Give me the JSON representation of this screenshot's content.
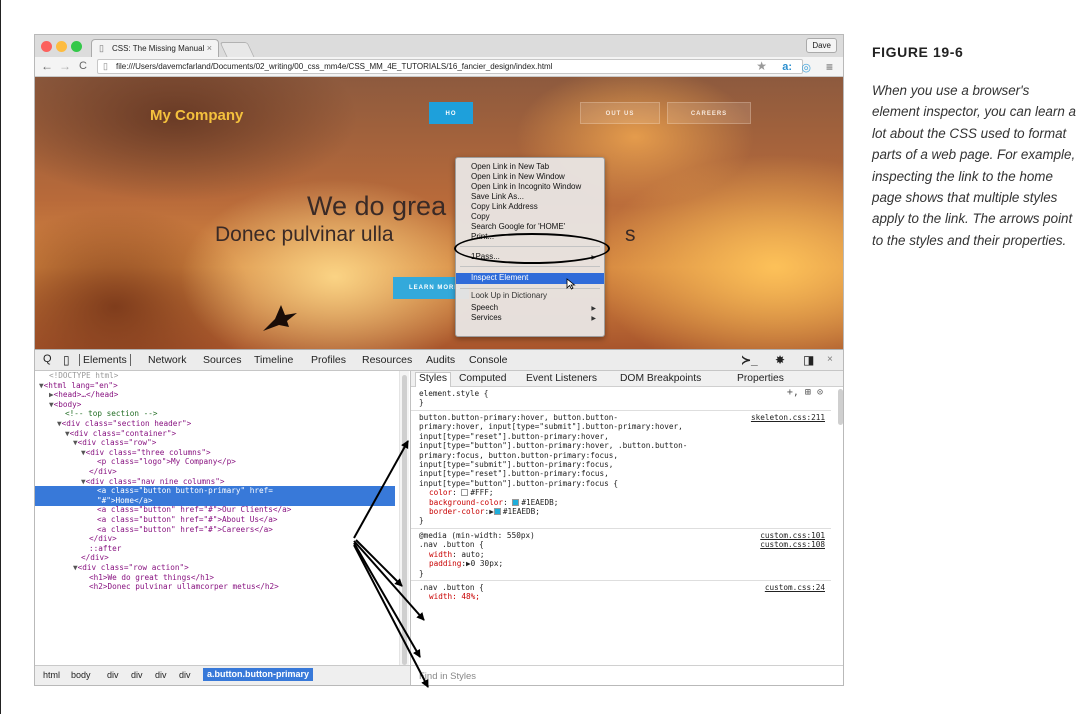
{
  "browser": {
    "tab_title": "CSS: The Missing Manual",
    "tab_close": "×",
    "user_name": "Dave",
    "url": "file:///Users/davemcfarland/Documents/02_writing/00_css_mm4e/CSS_MM_4E_TUTORIALS/16_fancier_design/index.html",
    "nav_icons": {
      "back": "←",
      "forward": "→",
      "reload": "C"
    },
    "toolbar_icons": {
      "star": "★",
      "ext_a": "a:",
      "ext_b": "◎",
      "menu": "≡"
    }
  },
  "webpage": {
    "logo": "My Company",
    "nav": {
      "home": "HO",
      "about": "OUT US",
      "careers": "CAREERS"
    },
    "hero_h1": "We do grea",
    "hero_h2": "Donec pulvinar ulla",
    "hero_h2_tail": "s",
    "learn_more": "LEARN MORE"
  },
  "context_menu": {
    "items": [
      "Open Link in New Tab",
      "Open Link in New Window",
      "Open Link in Incognito Window",
      "Save Link As...",
      "Copy Link Address",
      "Copy",
      "Search Google for 'HOME'",
      "Print...",
      "1Pass...",
      "Inspect Element",
      "Look Up in Dictionary",
      "Speech",
      "Services"
    ],
    "selected": "Inspect Element"
  },
  "devtools": {
    "tabs": [
      "Elements",
      "Network",
      "Sources",
      "Timeline",
      "Profiles",
      "Resources",
      "Audits",
      "Console"
    ],
    "active_tab": "Elements",
    "icons": {
      "search": "Q",
      "device": "▯",
      "drawer": "≻_",
      "settings": "✸",
      "dock": "◨",
      "close": "×"
    },
    "elements_lines": [
      "<!DOCTYPE html>",
      "<html lang=\"en\">",
      "<head>…</head>",
      "<body>",
      "<!-- top section -->",
      "<div class=\"section header\">",
      "<div class=\"container\">",
      "<div class=\"row\">",
      "<div class=\"three columns\">",
      "<p class=\"logo\">My Company</p>",
      "</div>",
      "<div class=\"nav nine columns\">",
      "<a class=\"button button-primary\" href=",
      "\"#\">Home</a>",
      "<a class=\"button\" href=\"#\">Our Clients</a>",
      "<a class=\"button\" href=\"#\">About Us</a>",
      "<a class=\"button\" href=\"#\">Careers</a>",
      "</div>",
      "::after",
      "</div>",
      "<div class=\"row action\">",
      "<h1>We do great things</h1>",
      "<h2>Donec pulvinar ullamcorper metus</h2>"
    ],
    "breadcrumbs": [
      "html",
      "body",
      "div",
      "div",
      "div",
      "div"
    ],
    "breadcrumb_selected": "a.button.button-primary",
    "styles_tabs": [
      "Styles",
      "Computed",
      "Event Listeners",
      "DOM Breakpoints",
      "Properties"
    ],
    "element_style": "element.style {",
    "element_style_close": "}",
    "style_toolbar_icons": "+, ⊞ ⊙",
    "rule1": {
      "selector_lines": [
        "button.button-primary:hover, button.button-",
        "primary:hover, input[type=\"submit\"].button-primary:hover,",
        "input[type=\"reset\"].button-primary:hover,",
        "input[type=\"button\"].button-primary:hover, .button.button-",
        "primary:focus, button.button-primary:focus,",
        "input[type=\"submit\"].button-primary:focus,",
        "input[type=\"reset\"].button-primary:focus,",
        "input[type=\"button\"].button-primary:focus {"
      ],
      "source": "skeleton.css:211",
      "props": [
        {
          "name": "color",
          "value": "#FFF;",
          "swatch": "#FFFFFF"
        },
        {
          "name": "background-color",
          "value": "#1EAEDB;",
          "swatch": "#1EAEDB"
        },
        {
          "name": "border-color",
          "value": "#1EAEDB;",
          "swatch": "#1EAEDB",
          "triangle": "▶"
        }
      ],
      "close": "}"
    },
    "rule2": {
      "media": "@media (min-width: 550px)",
      "media_source": "custom.css:101",
      "selector": ".nav .button {",
      "source": "custom.css:108",
      "props": [
        {
          "name": "width",
          "value": "auto;"
        },
        {
          "name": "padding",
          "value": "▶0 30px;"
        }
      ],
      "close": "}"
    },
    "rule3": {
      "selector": ".nav .button {",
      "source": "custom.css:24",
      "partial_prop": "width: 48%;"
    },
    "find_placeholder": "Find in Styles"
  },
  "caption": {
    "title": "FIGURE 19-6",
    "text": "When you use a browser's element inspector, you can learn a lot about the CSS used to format parts of a web page. For example, inspecting the link to the home page shows that multiple styles apply to the link. The arrows point to the styles and their properties."
  },
  "colors": {
    "accent": "#1EAEDB",
    "selection": "#3879D9",
    "logo": "#F4C13D",
    "traffic_red": "#FC615D",
    "traffic_yellow": "#FDBC40",
    "traffic_green": "#34C84A"
  }
}
